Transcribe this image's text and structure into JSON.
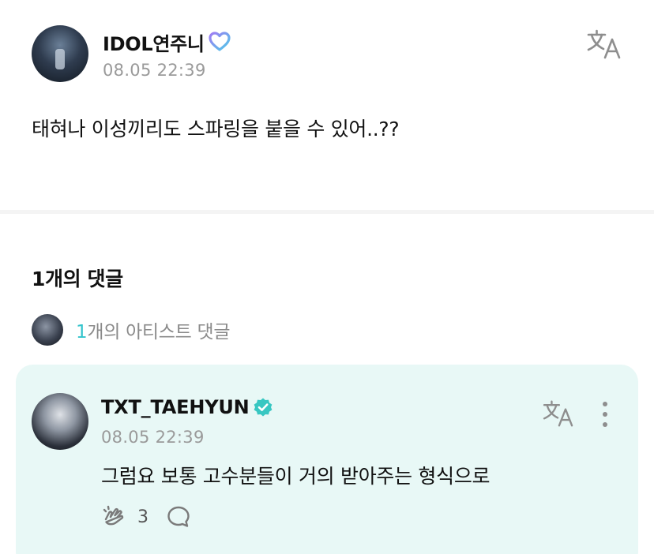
{
  "post": {
    "author": "IDOL연주니",
    "author_badge_icon": "weverse-heart-icon",
    "timestamp": "08.05 22:39",
    "body": "태혀나 이성끼리도 스파링을 붙을 수 있어..??",
    "translate_icon": "translate-icon"
  },
  "comments_section": {
    "count_label": "1개의 댓글",
    "artist_count_num": "1",
    "artist_count_text": "개의 아티스트 댓글"
  },
  "comment": {
    "author": "TXT_TAEHYUN",
    "verified_icon": "verified-badge-icon",
    "timestamp": "08.05 22:39",
    "text": "그럼요 보통 고수분들이 거의 받아주는 형식으로",
    "like_count": "3",
    "translate_icon": "translate-icon",
    "more_icon": "more-vertical-icon"
  },
  "colors": {
    "accent": "#33c4cc",
    "card_bg": "#e8f8f6",
    "muted_text": "#9a9a9a"
  }
}
